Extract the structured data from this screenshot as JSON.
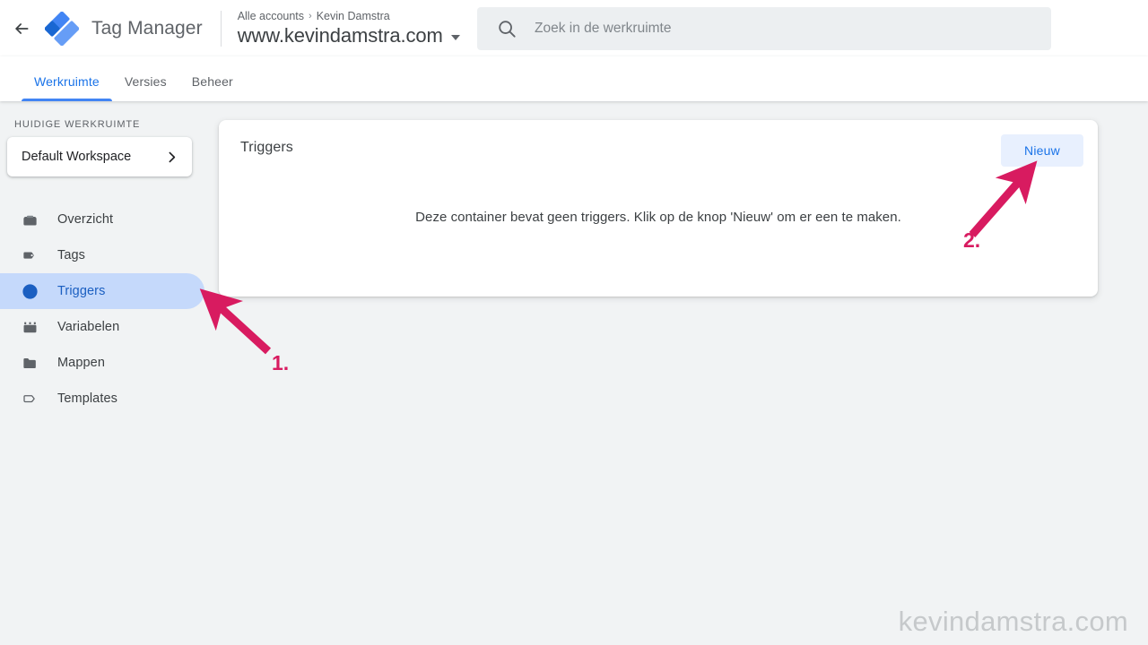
{
  "topbar": {
    "back_icon": "arrow-back-icon",
    "logo_icon": "google-tag-manager-logo",
    "product_title": "Tag Manager",
    "breadcrumb": {
      "account_label": "Alle accounts",
      "separator": "›",
      "current_account": "Kevin Damstra"
    },
    "container_name": "www.kevindamstra.com",
    "container_dropdown_icon": "caret-down-icon"
  },
  "search": {
    "icon": "search-icon",
    "placeholder": "Zoek in de werkruimte",
    "value": ""
  },
  "tabs": [
    {
      "label": "Werkruimte",
      "active": true
    },
    {
      "label": "Versies",
      "active": false
    },
    {
      "label": "Beheer",
      "active": false
    }
  ],
  "sidebar": {
    "section_label": "HUIDIGE WERKRUIMTE",
    "workspace": {
      "name": "Default Workspace",
      "chevron_icon": "chevron-right-icon"
    },
    "items": [
      {
        "label": "Overzicht",
        "icon": "overview-icon",
        "active": false
      },
      {
        "label": "Tags",
        "icon": "tag-icon",
        "active": false
      },
      {
        "label": "Triggers",
        "icon": "trigger-icon",
        "active": true
      },
      {
        "label": "Variabelen",
        "icon": "variables-icon",
        "active": false
      },
      {
        "label": "Mappen",
        "icon": "folder-icon",
        "active": false
      },
      {
        "label": "Templates",
        "icon": "template-tag-icon",
        "active": false
      }
    ]
  },
  "main": {
    "card_title": "Triggers",
    "new_button_label": "Nieuw",
    "empty_message": "Deze container bevat geen triggers. Klik op de knop 'Nieuw' om er een te maken."
  },
  "annotations": [
    {
      "number": "1.",
      "points_to": "sidebar-item-triggers",
      "color": "#d81b60"
    },
    {
      "number": "2.",
      "points_to": "new-trigger-button",
      "color": "#d81b60"
    }
  ],
  "watermark": "kevindamstra.com",
  "colors": {
    "page_background": "#f1f3f4",
    "surface": "#ffffff",
    "accent_blue": "#1a73e8",
    "active_nav_background": "#c5d9fb",
    "button_background": "#e8f0fe",
    "annotation_pink": "#d81b60",
    "search_background": "#eceff1"
  }
}
